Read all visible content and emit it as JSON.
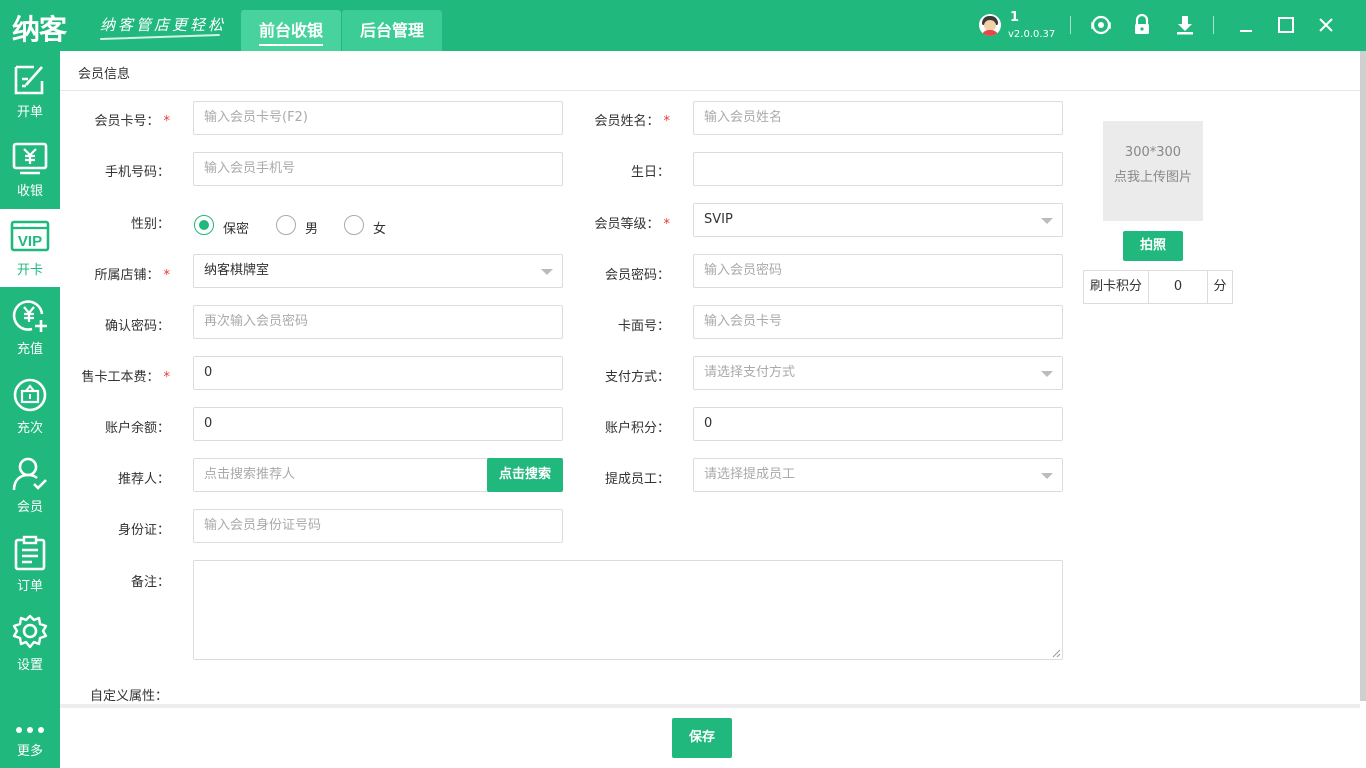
{
  "app": {
    "logo": "纳客",
    "slogan": "纳客管店更轻松",
    "tabs": [
      {
        "label": "前台收银",
        "active": true
      },
      {
        "label": "后台管理",
        "active": false
      }
    ],
    "user": "1",
    "version": "v2.0.0.37",
    "accent_color": "#21b87e"
  },
  "sidebar": {
    "items": [
      {
        "label": "开单",
        "icon": "edit-icon"
      },
      {
        "label": "收银",
        "icon": "cashier-icon"
      },
      {
        "label": "开卡",
        "icon": "vip-card-icon",
        "active": true
      },
      {
        "label": "充值",
        "icon": "recharge-icon"
      },
      {
        "label": "充次",
        "icon": "recharge-times-icon"
      },
      {
        "label": "会员",
        "icon": "member-icon"
      },
      {
        "label": "订单",
        "icon": "order-icon"
      },
      {
        "label": "设置",
        "icon": "gear-icon"
      },
      {
        "label": "更多",
        "icon": "more-icon"
      }
    ]
  },
  "form": {
    "section_title": "会员信息",
    "card_no": {
      "label": "会员卡号：",
      "placeholder": "输入会员卡号(F2)"
    },
    "name": {
      "label": "会员姓名：",
      "placeholder": "输入会员姓名"
    },
    "phone": {
      "label": "手机号码：",
      "placeholder": "输入会员手机号"
    },
    "birthday": {
      "label": "生日：",
      "value": ""
    },
    "gender": {
      "label": "性别：",
      "options": [
        "保密",
        "男",
        "女"
      ],
      "selected": "保密"
    },
    "level": {
      "label": "会员等级：",
      "value": "SVIP"
    },
    "store": {
      "label": "所属店铺：",
      "value": "纳客棋牌室"
    },
    "password": {
      "label": "会员密码：",
      "placeholder": "输入会员密码"
    },
    "confirm_password": {
      "label": "确认密码：",
      "placeholder": "再次输入会员密码"
    },
    "card_face_no": {
      "label": "卡面号：",
      "placeholder": "输入会员卡号"
    },
    "card_fee": {
      "label": "售卡工本费：",
      "value": "0"
    },
    "payment": {
      "label": "支付方式：",
      "placeholder": "请选择支付方式"
    },
    "balance": {
      "label": "账户余额：",
      "value": "0"
    },
    "points": {
      "label": "账户积分：",
      "value": "0"
    },
    "referrer": {
      "label": "推荐人：",
      "placeholder": "点击搜索推荐人",
      "button": "点击搜索"
    },
    "staff": {
      "label": "提成员工：",
      "placeholder": "请选择提成员工"
    },
    "id_card": {
      "label": "身份证：",
      "placeholder": "输入会员身份证号码"
    },
    "remark": {
      "label": "备注：",
      "value": ""
    },
    "custom_attr": {
      "label": "自定义属性："
    }
  },
  "photo": {
    "size_text": "300*300",
    "upload_text": "点我上传图片",
    "capture_button": "拍照",
    "swipe_points_label": "刷卡积分",
    "swipe_points_value": "0",
    "points_unit": "分"
  },
  "footer": {
    "save_button": "保存"
  }
}
